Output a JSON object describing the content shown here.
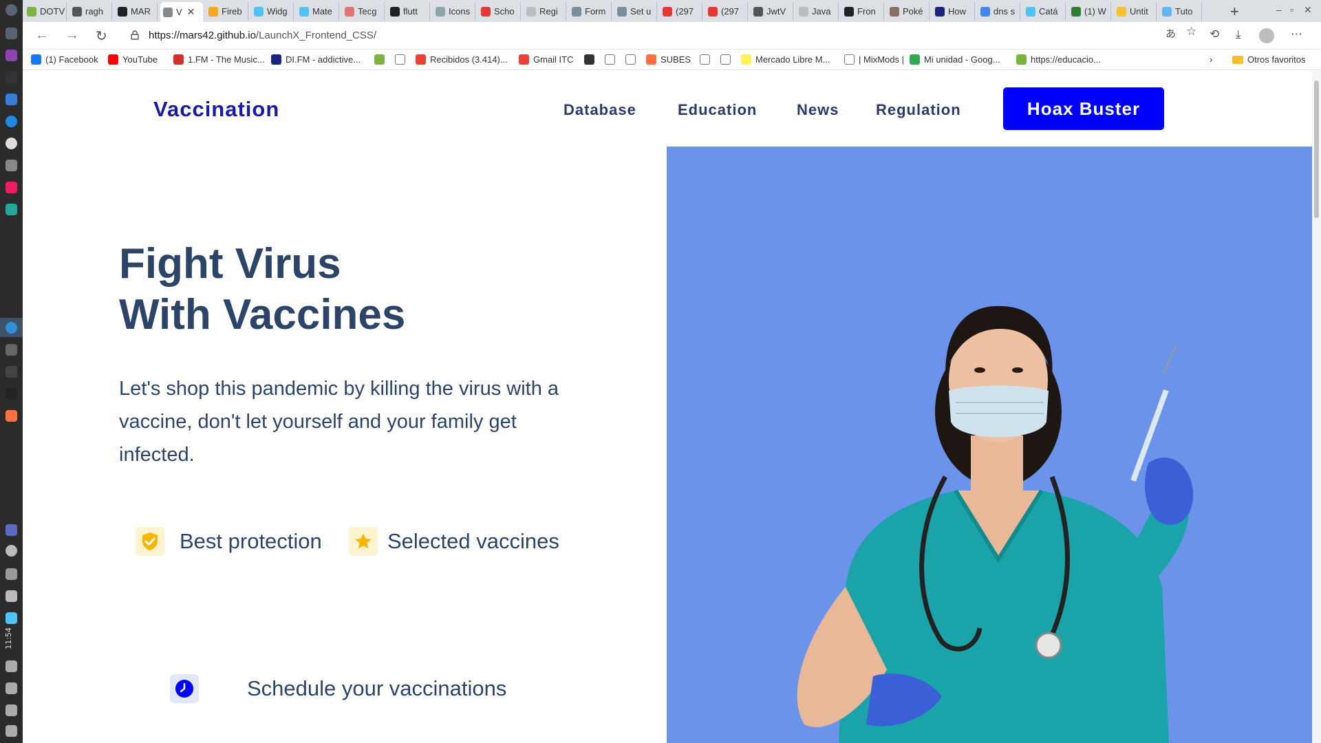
{
  "browser": {
    "tabs": [
      {
        "label": "DOTV",
        "color": "#7cb342"
      },
      {
        "label": "ragh",
        "color": "#555555"
      },
      {
        "label": "MAR",
        "color": "#222222"
      },
      {
        "label": "V",
        "color": "#888888",
        "active": true
      },
      {
        "label": "Fireb",
        "color": "#f5a623"
      },
      {
        "label": "Widg",
        "color": "#4fc3f7"
      },
      {
        "label": "Mate",
        "color": "#4fc3f7"
      },
      {
        "label": "Tecg",
        "color": "#e57373"
      },
      {
        "label": "flutt",
        "color": "#222222"
      },
      {
        "label": "Icons",
        "color": "#90a4ae"
      },
      {
        "label": "Scho",
        "color": "#e53935"
      },
      {
        "label": "Regi",
        "color": "#bdbdbd"
      },
      {
        "label": "Form",
        "color": "#78909c"
      },
      {
        "label": "Set u",
        "color": "#78909c"
      },
      {
        "label": "(297",
        "color": "#e53935"
      },
      {
        "label": "(297",
        "color": "#e53935"
      },
      {
        "label": "JwtV",
        "color": "#555555"
      },
      {
        "label": "Java",
        "color": "#bdbdbd"
      },
      {
        "label": "Fron",
        "color": "#222222"
      },
      {
        "label": "Poké",
        "color": "#8d6e63"
      },
      {
        "label": "How",
        "color": "#1a237e"
      },
      {
        "label": "dns s",
        "color": "#4285f4"
      },
      {
        "label": "Catá",
        "color": "#4fc3f7"
      },
      {
        "label": "(1) W",
        "color": "#2e7d32"
      },
      {
        "label": "Untit",
        "color": "#fbc02d"
      },
      {
        "label": "Tuto",
        "color": "#64b5f6"
      }
    ],
    "new_tab": "+",
    "url_domain": "https://mars42.github.io",
    "url_path": "/LaunchX_Frontend_CSS/",
    "bookmarks": [
      {
        "label": "(1) Facebook",
        "color": "#1877f2"
      },
      {
        "label": "YouTube",
        "color": "#ff0000"
      },
      {
        "label": "1.FM - The Music...",
        "color": "#d32f2f"
      },
      {
        "label": "DI.FM - addictive...",
        "color": "#1a237e"
      },
      {
        "label": "",
        "color": "#7cb342"
      },
      {
        "label": "",
        "color": "#ffffff"
      },
      {
        "label": "Recibidos (3.414)...",
        "color": "#ea4335"
      },
      {
        "label": "Gmail ITC",
        "color": "#ea4335"
      },
      {
        "label": "",
        "color": "#333333"
      },
      {
        "label": "",
        "color": "#ffffff"
      },
      {
        "label": "",
        "color": "#ffffff"
      },
      {
        "label": "SUBES",
        "color": "#ff7043"
      },
      {
        "label": "",
        "color": "#ffffff"
      },
      {
        "label": "",
        "color": "#ffffff"
      },
      {
        "label": "Mercado Libre M...",
        "color": "#fff159"
      },
      {
        "label": "| MixMods |",
        "color": "#ffffff"
      },
      {
        "label": "Mi unidad - Goog...",
        "color": "#34a853"
      },
      {
        "label": "https://educacio...",
        "color": "#7cb342"
      }
    ],
    "other_bookmarks": "Otros favoritos",
    "clock": "11:54"
  },
  "site": {
    "brand": "Vaccination",
    "nav": [
      "Database",
      "Education",
      "News",
      "Regulation"
    ],
    "cta": "Hoax Buster",
    "hero_title_line1": "Fight Virus",
    "hero_title_line2": "With Vaccines",
    "hero_description": "Let's shop this pandemic by killing the virus with a vaccine, don't let yourself and your family get infected.",
    "features": [
      {
        "label": "Best protection",
        "icon": "shield-check-icon"
      },
      {
        "label": "Selected vaccines",
        "icon": "star-icon"
      },
      {
        "label": "Schedule your vaccinations",
        "icon": "clock-icon"
      }
    ],
    "hero_image": "nurse-holding-syringe",
    "colors": {
      "brand": "#1a1aa6",
      "cta": "#0000ff",
      "text": "#2b4468",
      "hero_bg": "#6b93ea",
      "nurse_scrubs": "#1aa3a8",
      "gloves": "#3a5fd6"
    }
  }
}
